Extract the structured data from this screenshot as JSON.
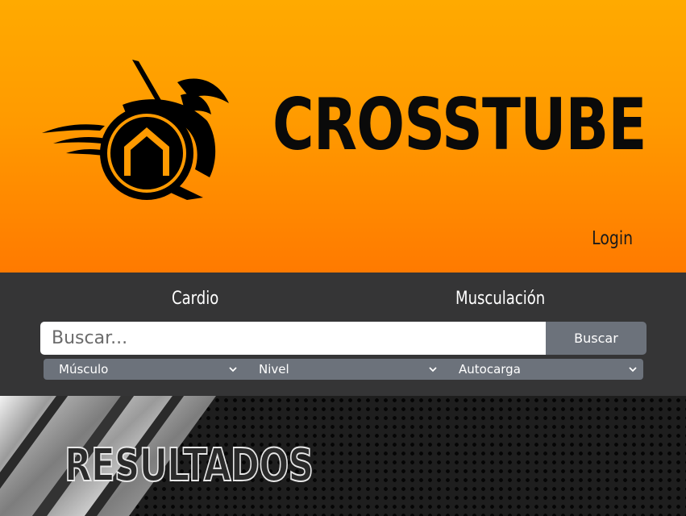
{
  "header": {
    "brand": "CROSSTUBE",
    "login_label": "Login",
    "logo_icon": "spartan-warrior-logo-icon",
    "background_color_top": "#ffaa00",
    "background_color_bottom": "#ff7a00"
  },
  "nav": {
    "links": [
      {
        "label": "Cardio"
      },
      {
        "label": "Musculación"
      }
    ]
  },
  "search": {
    "placeholder": "Buscar...",
    "value": "",
    "button_label": "Buscar"
  },
  "filters": [
    {
      "selected": "Músculo",
      "icon": "chevron-down-icon"
    },
    {
      "selected": "Nivel",
      "icon": "chevron-down-icon"
    },
    {
      "selected": "Autocarga",
      "icon": "chevron-down-icon"
    }
  ],
  "results_banner": {
    "title": "RESULTADOS"
  },
  "colors": {
    "navbar": "#353536",
    "button": "#6c727b"
  }
}
